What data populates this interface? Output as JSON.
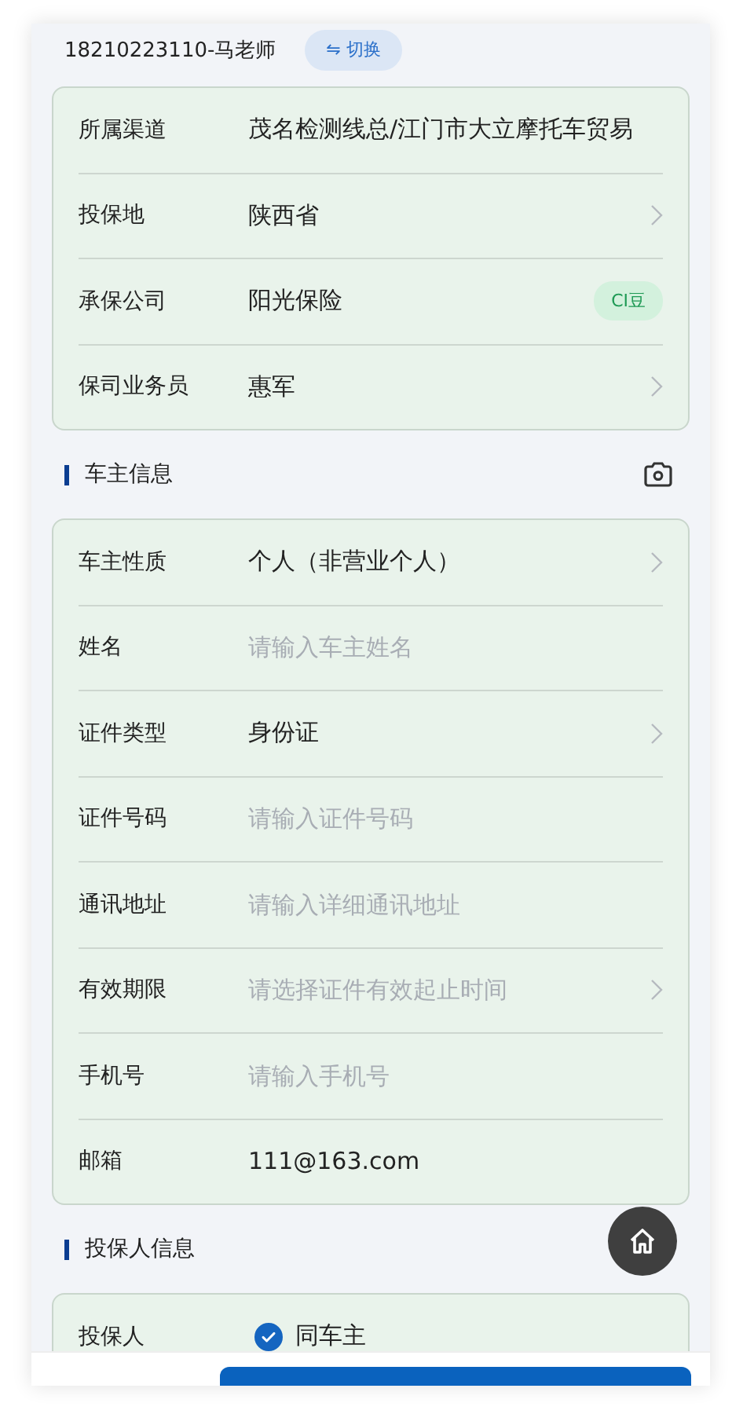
{
  "header": {
    "account": "18210223110-马老师",
    "switch_button": "⇋ 切换"
  },
  "channel_card": {
    "rows": [
      {
        "label": "所属渠道",
        "value": "茂名检测线总/江门市大立摩托车贸易",
        "chevron": false
      },
      {
        "label": "投保地",
        "value": "陕西省",
        "chevron": true
      },
      {
        "label": "承保公司",
        "value": "阳光保险",
        "chevron": false,
        "badge": "CI豆"
      },
      {
        "label": "保司业务员",
        "value": "惠军",
        "chevron": true
      }
    ]
  },
  "owner_section": {
    "title": "车主信息",
    "rows": [
      {
        "label": "车主性质",
        "value": "个人（非营业个人）",
        "chevron": true
      },
      {
        "label": "姓名",
        "placeholder": "请输入车主姓名",
        "chevron": false
      },
      {
        "label": "证件类型",
        "value": "身份证",
        "chevron": true
      },
      {
        "label": "证件号码",
        "placeholder": "请输入证件号码",
        "chevron": false
      },
      {
        "label": "通讯地址",
        "placeholder": "请输入详细通讯地址",
        "chevron": false
      },
      {
        "label": "有效期限",
        "placeholder": "请选择证件有效起止时间",
        "chevron": true
      },
      {
        "label": "手机号",
        "placeholder": "请输入手机号",
        "chevron": false
      },
      {
        "label": "邮箱",
        "value": "111@163.com",
        "chevron": false
      }
    ]
  },
  "applicant_section": {
    "title": "投保人信息",
    "rows": [
      {
        "label": "投保人",
        "option": "同车主",
        "checked": true
      }
    ]
  }
}
